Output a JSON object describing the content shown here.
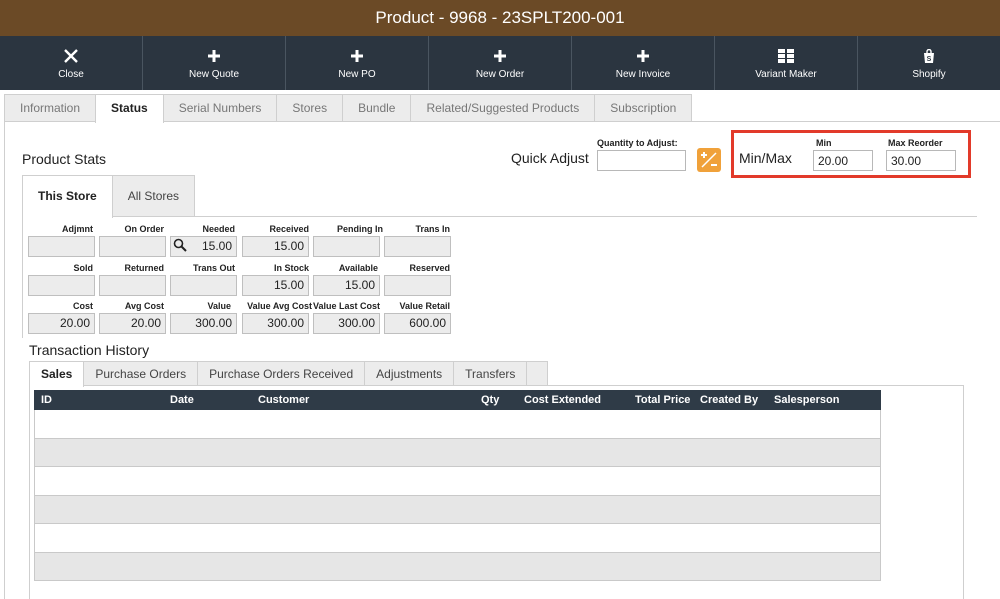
{
  "window": {
    "title": "Product - 9968 - 23SPLT200-001"
  },
  "toolbar": {
    "buttons": [
      {
        "label": "Close",
        "icon": "close-icon"
      },
      {
        "label": "New Quote",
        "icon": "plus-icon"
      },
      {
        "label": "New PO",
        "icon": "plus-icon"
      },
      {
        "label": "New Order",
        "icon": "plus-icon"
      },
      {
        "label": "New Invoice",
        "icon": "plus-icon"
      },
      {
        "label": "Variant Maker",
        "icon": "grid-icon"
      },
      {
        "label": "Shopify",
        "icon": "shopify-bag-icon"
      }
    ]
  },
  "tabs": [
    "Information",
    "Status",
    "Serial Numbers",
    "Stores",
    "Bundle",
    "Related/Suggested Products",
    "Subscription"
  ],
  "active_tab": "Status",
  "product_stats": {
    "title": "Product Stats"
  },
  "quick_adjust": {
    "label": "Quick Adjust",
    "qty_label": "Quantity to Adjust:",
    "qty_value": ""
  },
  "minmax": {
    "label": "Min/Max",
    "min_label": "Min",
    "min_value": "20.00",
    "max_label": "Max Reorder",
    "max_value": "30.00",
    "highlight_color": "#e23a2a"
  },
  "store_tabs": [
    "This Store",
    "All Stores"
  ],
  "stats": {
    "row1": {
      "labels": [
        "Adjmnt",
        "On Order",
        "Needed",
        "Received",
        "Pending In",
        "Trans In"
      ],
      "values": [
        "",
        "",
        "15.00",
        "15.00",
        "",
        ""
      ]
    },
    "row2": {
      "labels": [
        "Sold",
        "Returned",
        "Trans Out",
        "In Stock",
        "Available",
        "Reserved"
      ],
      "values": [
        "",
        "",
        "",
        "15.00",
        "15.00",
        ""
      ]
    },
    "row3": {
      "labels": [
        "Cost",
        "Avg Cost",
        "Value",
        "Value Avg Cost",
        "Value Last Cost",
        "Value Retail"
      ],
      "values": [
        "20.00",
        "20.00",
        "300.00",
        "300.00",
        "300.00",
        "600.00"
      ]
    }
  },
  "transaction_history": {
    "title": "Transaction History",
    "tabs": [
      "Sales",
      "Purchase Orders",
      "Purchase Orders Received",
      "Adjustments",
      "Transfers"
    ],
    "columns": [
      "ID",
      "Date",
      "Customer",
      "Qty",
      "Cost Extended",
      "Total Price",
      "Created By",
      "Salesperson"
    ],
    "rows": []
  },
  "colors": {
    "titlebar": "#6b4a26",
    "toolbar": "#2b3540",
    "grid_header": "#2f3b47",
    "accent_button": "#f0a13a"
  }
}
